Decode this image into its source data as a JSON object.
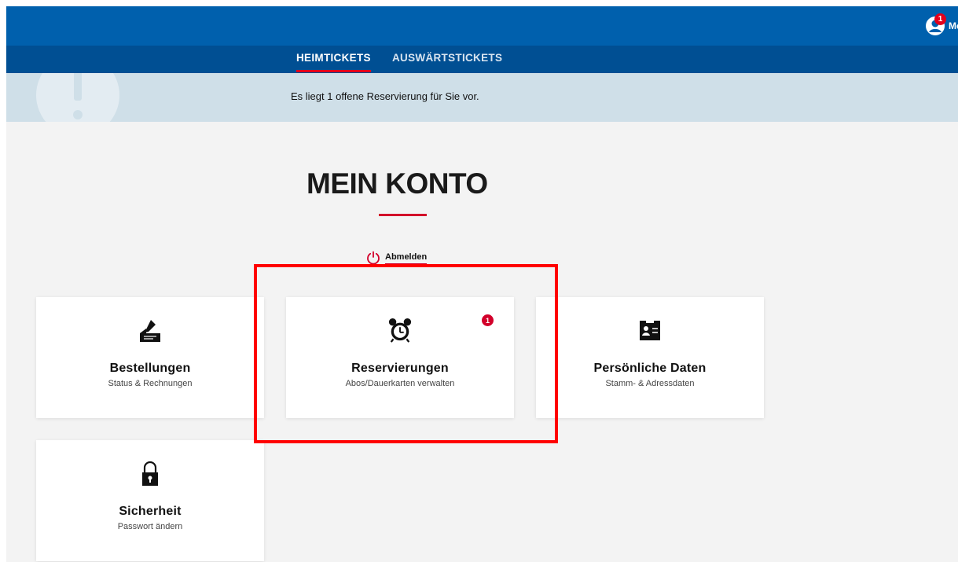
{
  "header": {
    "user_badge_count": "1",
    "user_label": "Mein Konto"
  },
  "nav": {
    "tabs": [
      {
        "label": "HEIMTICKETS",
        "active": true
      },
      {
        "label": "AUSWÄRTSTICKETS",
        "active": false
      }
    ]
  },
  "notice": {
    "text": "Es liegt 1 offene Reservierung für Sie vor."
  },
  "main": {
    "title": "MEIN KONTO",
    "logout_label": "Abmelden"
  },
  "cards": [
    {
      "title": "Bestellungen",
      "subtitle": "Status & Rechnungen",
      "icon": "signature-icon"
    },
    {
      "title": "Reservierungen",
      "subtitle": "Abos/Dauerkarten verwalten",
      "icon": "alarm-clock-icon",
      "badge": "1"
    },
    {
      "title": "Persönliche Daten",
      "subtitle": "Stamm- & Adressdaten",
      "icon": "contact-card-icon"
    },
    {
      "title": "Sicherheit",
      "subtitle": "Passwort ändern",
      "icon": "lock-icon"
    }
  ],
  "colors": {
    "topbar": "#0060ad",
    "navbar": "#004f93",
    "accent": "#d2002a",
    "notice_bg": "#cfdfe8",
    "page_bg": "#f3f3f3",
    "highlight": "#ff0000"
  }
}
